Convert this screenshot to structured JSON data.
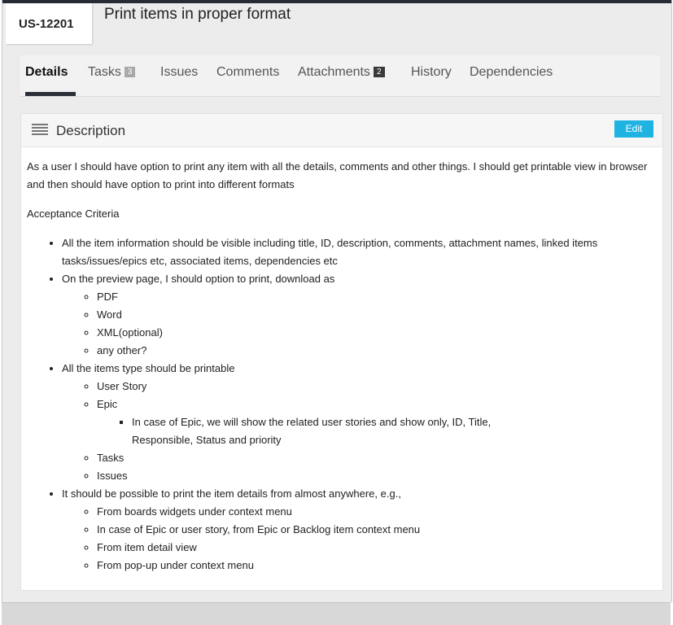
{
  "item": {
    "id": "US-12201",
    "title": "Print items in proper format"
  },
  "tabs": [
    {
      "label": "Details",
      "count": null
    },
    {
      "label": "Tasks",
      "count": "3"
    },
    {
      "label": "Issues",
      "count": null
    },
    {
      "label": "Comments",
      "count": null
    },
    {
      "label": "Attachments",
      "count": "2"
    },
    {
      "label": "History",
      "count": null
    },
    {
      "label": "Dependencies",
      "count": null
    }
  ],
  "description": {
    "header": "Description",
    "edit_label": "Edit",
    "intro": "As a user I should have option to print any item with all the details, comments and other things. I should get printable view in browser and then should have option to print into different formats",
    "criteria_heading": "Acceptance Criteria",
    "bullets": {
      "b1": "All the item information should be visible including title, ID, description, comments, attachment names, linked items tasks/issues/epics etc, associated items, dependencies etc",
      "b2": "On the preview page, I should option to print, download as",
      "b2_sub": [
        "PDF",
        "Word",
        "XML(optional)",
        "any other?"
      ],
      "b3": "All the items type should be printable",
      "b3_sub": [
        "User Story",
        "Epic",
        "Tasks",
        "Issues"
      ],
      "b3_epic_sub": "In case of Epic, we will show the related user stories and show only, ID, Title, Responsible, Status and priority",
      "b4": "It should be possible to print the item details from almost anywhere, e.g.,",
      "b4_sub": [
        "From boards widgets under context menu",
        "In case of Epic or user story, from Epic or Backlog item context menu",
        "From item detail view",
        "From pop-up under context menu"
      ]
    }
  },
  "colors": {
    "accent": "#1fb3e2",
    "top_bar": "#262c36"
  }
}
